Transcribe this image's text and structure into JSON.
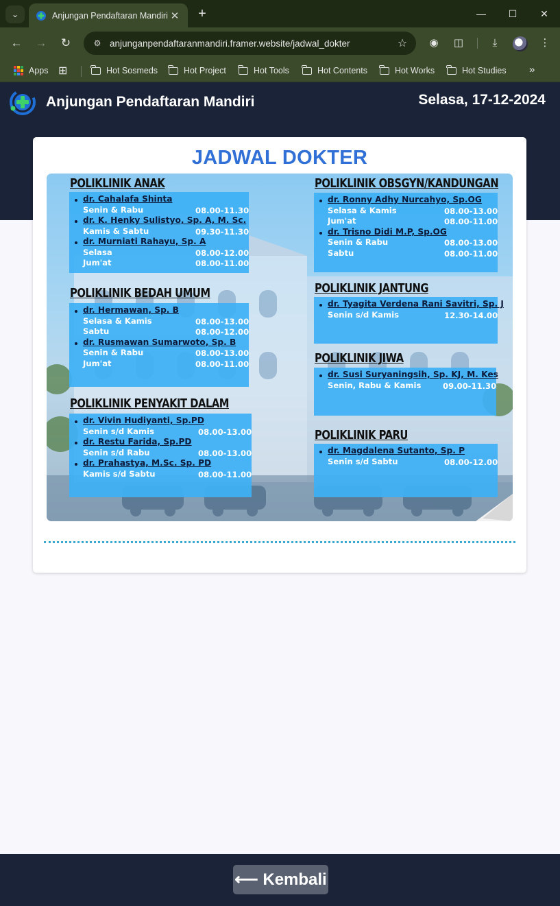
{
  "browser": {
    "tab_title": "Anjungan Pendaftaran Mandiri",
    "url": "anjunganpendaftaranmandiri.framer.website/jadwal_dokter",
    "bookmarks": [
      {
        "label": "Apps"
      },
      {
        "label": "Hot Sosmeds"
      },
      {
        "label": "Hot Project"
      },
      {
        "label": "Hot Tools"
      },
      {
        "label": "Hot Contents"
      },
      {
        "label": "Hot Works"
      },
      {
        "label": "Hot Studies"
      }
    ]
  },
  "header": {
    "title": "Anjungan Pendaftaran Mandiri",
    "date": "Selasa, 17-12-2024"
  },
  "card": {
    "title": "JADWAL DOKTER"
  },
  "schedule": {
    "left": [
      {
        "name": "POLIKLINIK ANAK",
        "doctors": [
          {
            "name": "dr. Cahalafa Shinta",
            "slots": [
              {
                "days": "Senin & Rabu",
                "time": "08.00-11.30"
              }
            ]
          },
          {
            "name": "dr. K. Henky Sulistyo, Sp. A, M. Sc.",
            "slots": [
              {
                "days": "Kamis & Sabtu",
                "time": "09.30-11.30"
              }
            ]
          },
          {
            "name": "dr. Murniati Rahayu, Sp. A",
            "slots": [
              {
                "days": "Selasa",
                "time": "08.00-12.00"
              },
              {
                "days": "Jum'at",
                "time": "08.00-11.00"
              }
            ]
          }
        ]
      },
      {
        "name": "POLIKLINIK BEDAH UMUM",
        "doctors": [
          {
            "name": "dr. Hermawan, Sp. B",
            "slots": [
              {
                "days": "Selasa & Kamis",
                "time": "08.00-13.00"
              },
              {
                "days": "Sabtu",
                "time": "08.00-12.00"
              }
            ]
          },
          {
            "name": "dr. Rusmawan Sumarwoto, Sp. B",
            "slots": [
              {
                "days": "Senin & Rabu",
                "time": "08.00-13.00"
              },
              {
                "days": "Jum'at",
                "time": "08.00-11.00"
              }
            ]
          }
        ]
      },
      {
        "name": "POLIKLINIK PENYAKIT DALAM",
        "doctors": [
          {
            "name": "dr. Vivin Hudiyanti, Sp.PD",
            "slots": [
              {
                "days": "Senin s/d Kamis",
                "time": "08.00-13.00"
              }
            ]
          },
          {
            "name": "dr. Restu Farida, Sp.PD",
            "slots": [
              {
                "days": "Senin s/d Rabu",
                "time": "08.00-13.00"
              }
            ]
          },
          {
            "name": "dr. Prahastya, M.Sc. Sp. PD",
            "slots": [
              {
                "days": "Kamis s/d Sabtu",
                "time": "08.00-11.00"
              }
            ]
          }
        ]
      }
    ],
    "right": [
      {
        "name": "POLIKLINIK OBSGYN/KANDUNGAN",
        "doctors": [
          {
            "name": "dr. Ronny Adhy Nurcahyo, Sp.OG",
            "slots": [
              {
                "days": "Selasa & Kamis",
                "time": "08.00-13.00"
              },
              {
                "days": "Jum'at",
                "time": "08.00-11.00"
              }
            ]
          },
          {
            "name": "dr. Trisno Didi M.P, Sp.OG",
            "slots": [
              {
                "days": "Senin & Rabu",
                "time": "08.00-13.00"
              },
              {
                "days": "Sabtu",
                "time": "08.00-11.00"
              }
            ]
          }
        ]
      },
      {
        "name": "POLIKLINIK JANTUNG",
        "doctors": [
          {
            "name": "dr. Tyagita Verdena Rani Savitri, Sp. J",
            "slots": [
              {
                "days": "Senin s/d Kamis",
                "time": "12.30-14.00"
              }
            ]
          }
        ]
      },
      {
        "name": "POLIKLINIK JIWA",
        "doctors": [
          {
            "name": "dr. Susi Suryaningsih, Sp. KJ, M. Kes",
            "slots": [
              {
                "days": "Senin, Rabu & Kamis",
                "time": "09.00-11.30"
              }
            ]
          }
        ]
      },
      {
        "name": "POLIKLINIK PARU",
        "doctors": [
          {
            "name": "dr. Magdalena Sutanto, Sp. P",
            "slots": [
              {
                "days": "Senin s/d Sabtu",
                "time": "08.00-12.00"
              }
            ]
          }
        ]
      }
    ]
  },
  "footer": {
    "back_label": "⟵ Kembali"
  },
  "colors": {
    "header_bg": "#1b2338",
    "title_blue": "#2f6fd6",
    "panel_blue": "#3eb0f5",
    "divider_dots": "#3aa8d0"
  }
}
